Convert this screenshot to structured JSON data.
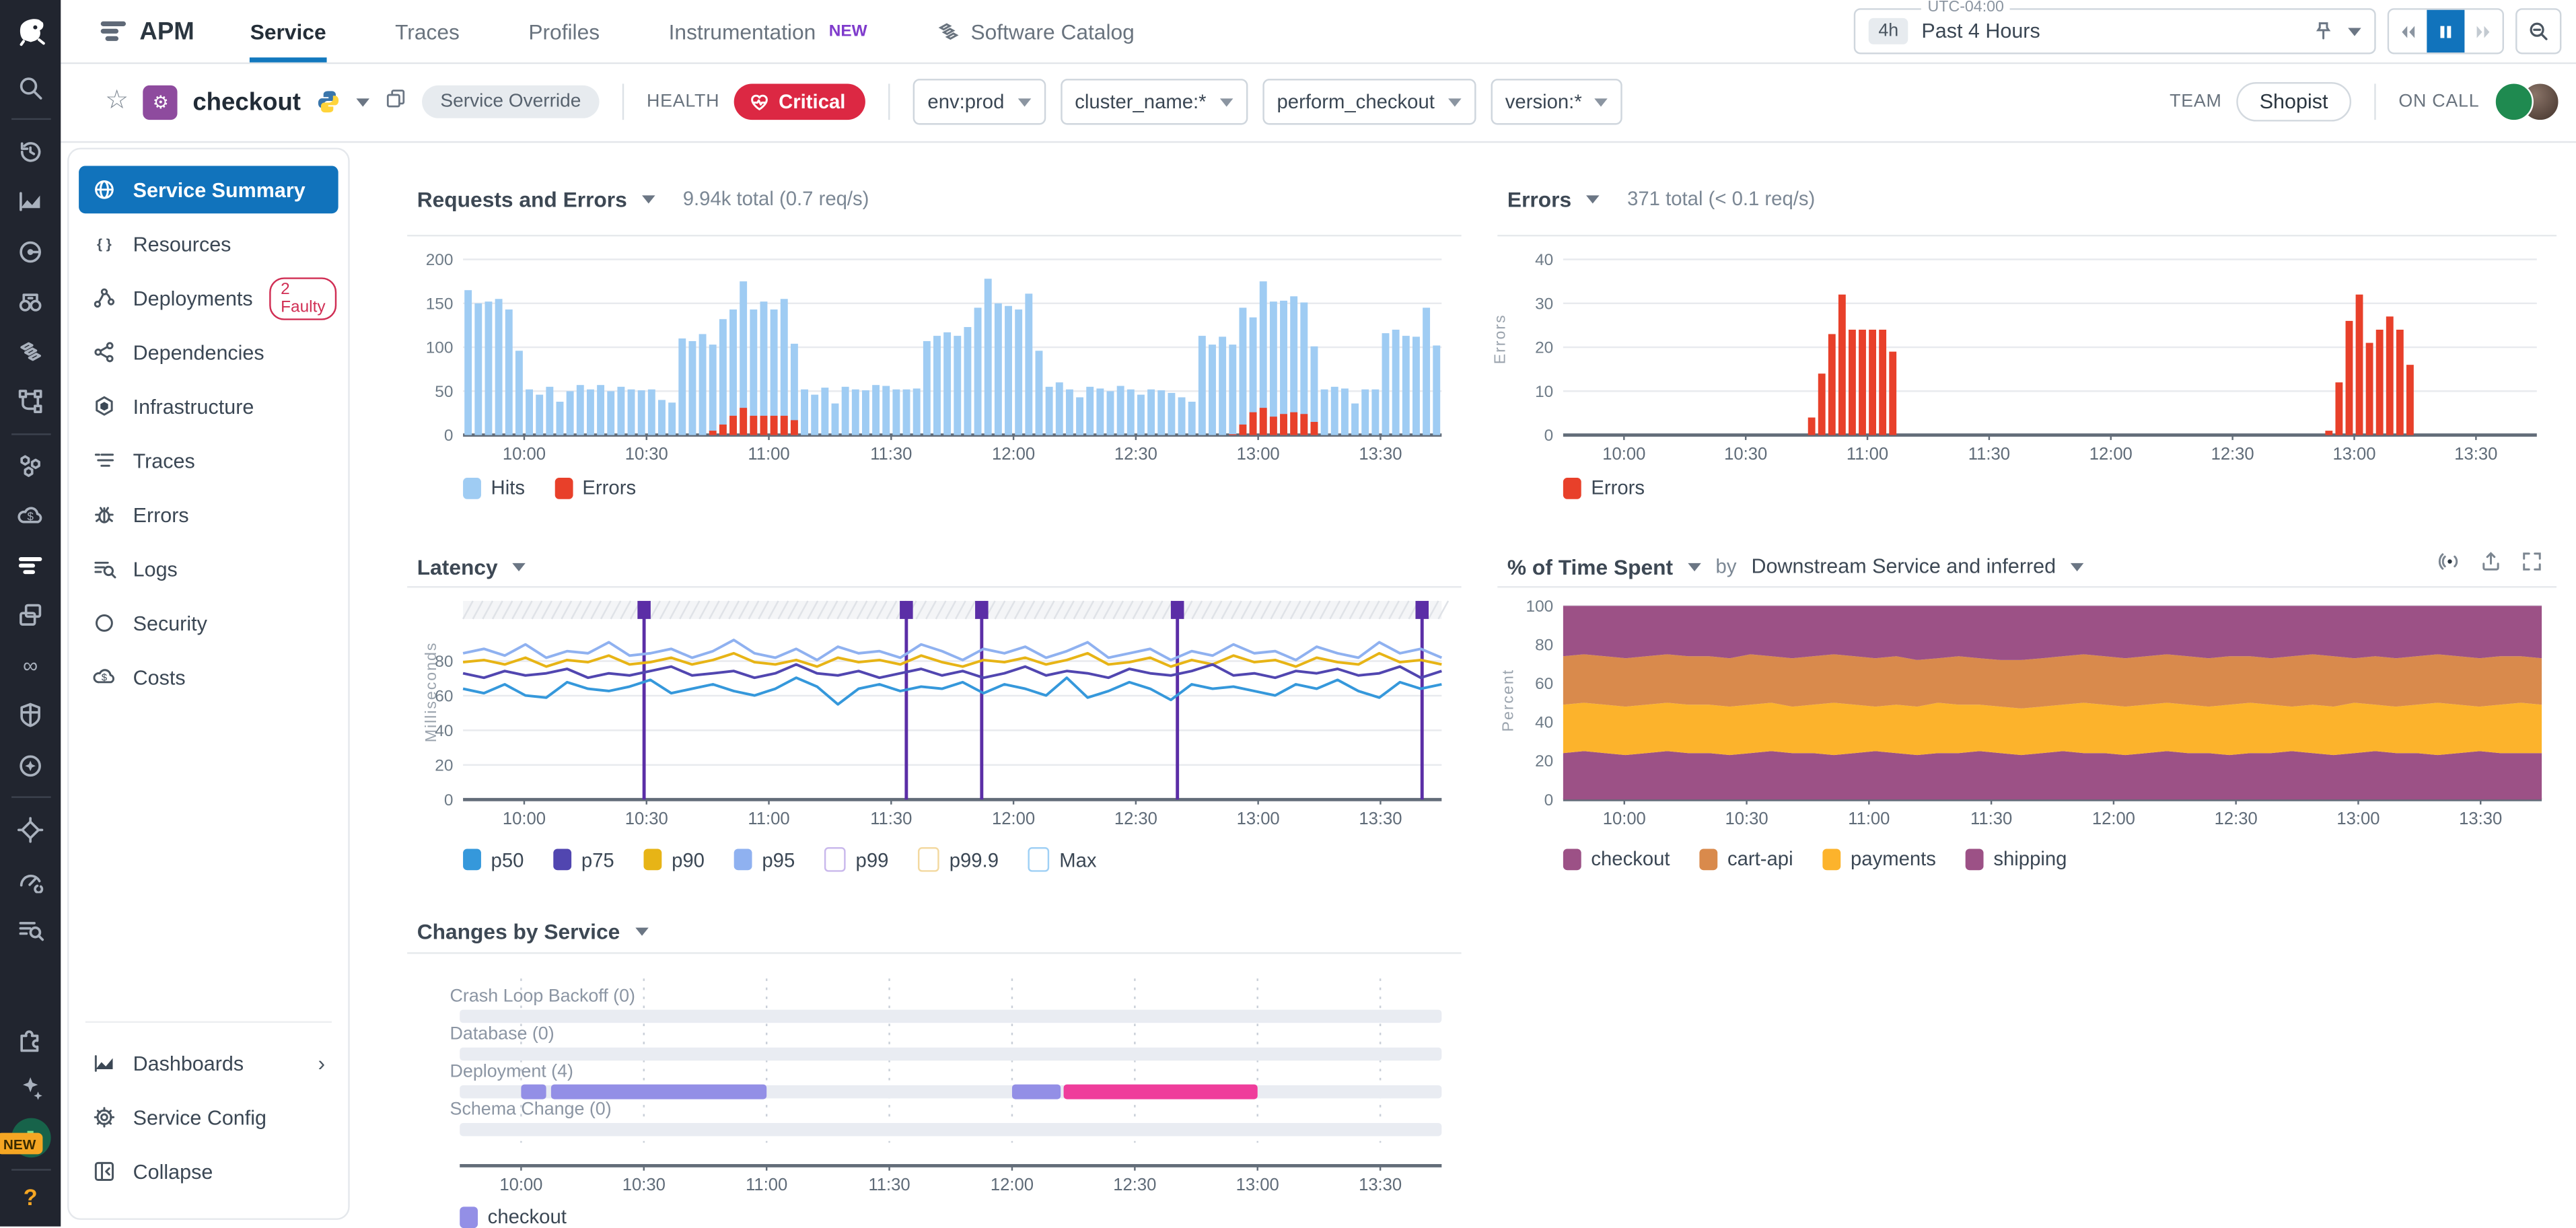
{
  "nav": {
    "product": "APM",
    "tabs": [
      {
        "label": "Service",
        "active": true
      },
      {
        "label": "Traces"
      },
      {
        "label": "Profiles"
      },
      {
        "label": "Instrumentation",
        "badge": "NEW"
      },
      {
        "label": "Software Catalog",
        "icon": "catalog"
      }
    ],
    "time": {
      "tz": "UTC-04:00",
      "range_short": "4h",
      "range_label": "Past 4 Hours"
    }
  },
  "header": {
    "service": "checkout",
    "override_pill": "Service Override",
    "health_label": "HEALTH",
    "health_status": "Critical",
    "filters": [
      "env:prod",
      "cluster_name:*",
      "perform_checkout",
      "version:*"
    ],
    "team_label": "TEAM",
    "team": "Shopist",
    "oncall_label": "ON CALL"
  },
  "sidebar": {
    "items": [
      {
        "label": "Service Summary",
        "icon": "globe",
        "active": true
      },
      {
        "label": "Resources",
        "icon": "braces"
      },
      {
        "label": "Deployments",
        "icon": "deploy",
        "badge": "2 Faulty"
      },
      {
        "label": "Dependencies",
        "icon": "deps"
      },
      {
        "label": "Infrastructure",
        "icon": "hexagon"
      },
      {
        "label": "Traces",
        "icon": "traces"
      },
      {
        "label": "Errors",
        "icon": "bug"
      },
      {
        "label": "Logs",
        "icon": "logs"
      },
      {
        "label": "Security",
        "icon": "shield"
      },
      {
        "label": "Costs",
        "icon": "cloudcost"
      }
    ],
    "footer": [
      {
        "label": "Dashboards",
        "icon": "dash",
        "chevron": true
      },
      {
        "label": "Service Config",
        "icon": "gear"
      },
      {
        "label": "Collapse",
        "icon": "collapse"
      }
    ]
  },
  "rail_icons": {
    "groups": [
      [
        "search"
      ],
      [
        "history",
        "dashboards",
        "infrastructure",
        "watchdog",
        "software-catalog",
        "service-map"
      ],
      [
        "containers",
        "cloud-cost",
        "apm",
        "rum",
        "ci",
        "security",
        "service-management"
      ],
      [
        "error-tracking",
        "performance",
        "log-search"
      ]
    ],
    "active": "apm",
    "bottom": [
      "integrations",
      "bits-ai"
    ],
    "new_badge": "NEW"
  },
  "chart_data": [
    {
      "id": "requests",
      "type": "bar",
      "title": "Requests and Errors",
      "subtitle": "9.94k total (0.7 req/s)",
      "ylim": [
        0,
        200
      ],
      "yticks": [
        0,
        50,
        100,
        150,
        200
      ],
      "xticks": [
        "10:00",
        "10:30",
        "11:00",
        "11:30",
        "12:00",
        "12:30",
        "13:00",
        "13:30"
      ],
      "legend": [
        {
          "label": "Hits",
          "color": "#9fccf3"
        },
        {
          "label": "Errors",
          "color": "#e8402a"
        }
      ],
      "hits": [
        165,
        150,
        152,
        155,
        143,
        96,
        52,
        46,
        55,
        38,
        50,
        57,
        52,
        57,
        50,
        55,
        52,
        51,
        52,
        40,
        37,
        110,
        107,
        115,
        103,
        132,
        143,
        175,
        143,
        152,
        143,
        155,
        104,
        52,
        46,
        54,
        36,
        55,
        52,
        51,
        57,
        56,
        52,
        52,
        53,
        107,
        113,
        117,
        113,
        123,
        145,
        178,
        150,
        147,
        143,
        161,
        96,
        55,
        60,
        52,
        43,
        55,
        53,
        50,
        56,
        52,
        46,
        52,
        51,
        48,
        43,
        38,
        113,
        103,
        112,
        103,
        145,
        134,
        175,
        152,
        153,
        158,
        151,
        101,
        52,
        55,
        53,
        36,
        52,
        52,
        116,
        120,
        113,
        112,
        145,
        102
      ],
      "errors": [
        0,
        0,
        0,
        0,
        0,
        0,
        0,
        0,
        0,
        0,
        0,
        0,
        0,
        0,
        0,
        0,
        0,
        0,
        0,
        0,
        0,
        0,
        0,
        0,
        5,
        12,
        22,
        31,
        22,
        22,
        22,
        22,
        17,
        0,
        0,
        0,
        0,
        0,
        0,
        0,
        0,
        0,
        0,
        0,
        0,
        0,
        0,
        0,
        0,
        0,
        0,
        0,
        0,
        0,
        0,
        0,
        0,
        0,
        0,
        0,
        0,
        0,
        0,
        0,
        0,
        0,
        0,
        0,
        0,
        0,
        0,
        0,
        0,
        0,
        0,
        1,
        12,
        26,
        31,
        21,
        24,
        26,
        24,
        15,
        0,
        0,
        0,
        0,
        0,
        0,
        0,
        0,
        0,
        0,
        0,
        0
      ]
    },
    {
      "id": "errors",
      "type": "bar",
      "title": "Errors",
      "subtitle": "371 total (< 0.1 req/s)",
      "ylabel": "Errors",
      "ylim": [
        0,
        40
      ],
      "yticks": [
        0,
        10,
        20,
        30,
        40
      ],
      "xticks": [
        "10:00",
        "10:30",
        "11:00",
        "11:30",
        "12:00",
        "12:30",
        "13:00",
        "13:30"
      ],
      "legend": [
        {
          "label": "Errors",
          "color": "#e8402a"
        }
      ],
      "errors": [
        0,
        0,
        0,
        0,
        0,
        0,
        0,
        0,
        0,
        0,
        0,
        0,
        0,
        0,
        0,
        0,
        0,
        0,
        0,
        0,
        0,
        0,
        0,
        0,
        4,
        14,
        23,
        32,
        24,
        24,
        24,
        24,
        19,
        0,
        0,
        0,
        0,
        0,
        0,
        0,
        0,
        0,
        0,
        0,
        0,
        0,
        0,
        0,
        0,
        0,
        0,
        0,
        0,
        0,
        0,
        0,
        0,
        0,
        0,
        0,
        0,
        0,
        0,
        0,
        0,
        0,
        0,
        0,
        0,
        0,
        0,
        0,
        0,
        0,
        0,
        1,
        12,
        26,
        32,
        21,
        24,
        27,
        24,
        16,
        0,
        0,
        0,
        0,
        0,
        0,
        0,
        0,
        0,
        0,
        0,
        0
      ]
    },
    {
      "id": "latency",
      "type": "line",
      "title": "Latency",
      "ylabel": "Milliseconds",
      "ylim": [
        0,
        92
      ],
      "yticks": [
        0,
        20,
        40,
        60,
        80
      ],
      "xticks": [
        "10:00",
        "10:30",
        "11:00",
        "11:30",
        "12:00",
        "12:30",
        "13:00",
        "13:30"
      ],
      "deployment_markers": [
        0.185,
        0.453,
        0.53,
        0.73,
        0.98
      ],
      "marker_color": "#5b2ea6",
      "legend": [
        {
          "label": "p50",
          "color": "#3598db",
          "filled": true
        },
        {
          "label": "p75",
          "color": "#5146b0",
          "filled": true
        },
        {
          "label": "p90",
          "color": "#e7b416",
          "filled": true
        },
        {
          "label": "p95",
          "color": "#8fb1f0",
          "filled": true
        },
        {
          "label": "p99",
          "color": "#c9b8ec",
          "filled": false
        },
        {
          "label": "p99.9",
          "color": "#f3d9a0",
          "filled": false
        },
        {
          "label": "Max",
          "color": "#9fd0f5",
          "filled": false
        }
      ],
      "series": [
        {
          "name": "p95",
          "color": "#8fb1f0",
          "values": [
            66,
            68,
            65,
            70,
            64,
            67,
            66,
            71,
            65,
            66,
            68,
            64,
            67,
            72,
            66,
            64,
            68,
            63,
            69,
            66,
            67,
            64,
            70,
            67,
            63,
            68,
            66,
            69,
            64,
            67,
            71,
            64,
            66,
            68,
            63,
            67,
            65,
            70,
            66,
            67,
            63,
            69,
            66,
            64,
            71,
            66,
            68,
            64
          ]
        },
        {
          "name": "p90",
          "color": "#e7b416",
          "values": [
            62,
            63,
            61,
            64,
            60,
            63,
            62,
            65,
            61,
            62,
            64,
            61,
            63,
            66,
            62,
            61,
            63,
            60,
            64,
            62,
            63,
            61,
            65,
            62,
            60,
            63,
            62,
            64,
            61,
            63,
            66,
            61,
            62,
            64,
            60,
            63,
            61,
            65,
            62,
            63,
            60,
            64,
            62,
            61,
            66,
            62,
            63,
            61
          ]
        },
        {
          "name": "p75",
          "color": "#5146b0",
          "values": [
            57,
            55,
            58,
            56,
            57,
            59,
            55,
            57,
            56,
            58,
            60,
            56,
            57,
            58,
            55,
            57,
            61,
            57,
            56,
            58,
            55,
            57,
            59,
            56,
            58,
            55,
            57,
            60,
            56,
            58,
            57,
            55,
            59,
            57,
            56,
            58,
            61,
            56,
            57,
            55,
            58,
            57,
            59,
            56,
            57,
            60,
            55,
            58
          ]
        },
        {
          "name": "p50",
          "color": "#3598db",
          "values": [
            50,
            48,
            52,
            47,
            46,
            53,
            50,
            49,
            51,
            54,
            48,
            50,
            52,
            49,
            47,
            50,
            55,
            51,
            43,
            50,
            52,
            49,
            51,
            50,
            53,
            48,
            52,
            50,
            47,
            55,
            46,
            49,
            53,
            50,
            45,
            52,
            50,
            51,
            49,
            47,
            52,
            50,
            54,
            49,
            46,
            53,
            50,
            52
          ]
        }
      ]
    },
    {
      "id": "time_spent",
      "type": "area",
      "title": "% of Time Spent",
      "by_label": "by",
      "group_label": "Downstream Service and inferred",
      "ylabel": "Percent",
      "ylim": [
        0,
        100
      ],
      "yticks": [
        0,
        20,
        40,
        60,
        80,
        100
      ],
      "xticks": [
        "10:00",
        "10:30",
        "11:00",
        "11:30",
        "12:00",
        "12:30",
        "13:00",
        "13:30"
      ],
      "legend": [
        {
          "label": "checkout",
          "color": "#9c5186"
        },
        {
          "label": "cart-api",
          "color": "#d98a4c"
        },
        {
          "label": "payments",
          "color": "#fcb32c"
        },
        {
          "label": "shipping",
          "color": "#9c5186"
        }
      ],
      "band_colors": [
        "#9c5186",
        "#fcb32c",
        "#d98a4c",
        "#9c5186"
      ],
      "boundaries": [
        [
          24,
          25,
          24,
          23,
          24,
          25,
          24,
          24,
          23,
          24,
          25,
          24,
          24,
          23,
          24,
          25,
          24,
          23,
          24,
          24,
          25,
          24,
          23,
          24,
          25,
          24,
          24,
          23,
          24,
          25,
          24,
          24,
          23,
          24,
          24,
          25,
          24,
          23,
          24,
          25,
          24,
          24,
          23,
          24,
          25,
          24,
          24,
          24
        ],
        [
          49,
          50,
          49,
          48,
          49,
          50,
          49,
          49,
          48,
          49,
          50,
          48,
          49,
          50,
          49,
          48,
          49,
          48,
          50,
          49,
          49,
          48,
          47,
          48,
          49,
          50,
          49,
          48,
          49,
          50,
          49,
          48,
          49,
          50,
          49,
          48,
          49,
          48,
          50,
          49,
          48,
          49,
          50,
          49,
          48,
          49,
          50,
          49
        ],
        [
          74,
          75,
          74,
          73,
          74,
          75,
          74,
          74,
          73,
          75,
          74,
          73,
          74,
          75,
          74,
          73,
          74,
          72,
          73,
          74,
          73,
          72,
          72,
          73,
          74,
          75,
          74,
          73,
          74,
          75,
          74,
          73,
          74,
          74,
          73,
          74,
          75,
          74,
          73,
          74,
          73,
          74,
          75,
          74,
          73,
          74,
          74,
          73
        ]
      ]
    },
    {
      "id": "changes",
      "type": "timeline",
      "title": "Changes by Service",
      "rows": [
        {
          "label": "Crash Loop Backoff (0)",
          "segments": []
        },
        {
          "label": "Database (0)",
          "segments": []
        },
        {
          "label": "Deployment (4)",
          "segments": [
            {
              "from": 0.0625,
              "to": 0.088,
              "color": "#938fe6"
            },
            {
              "from": 0.093,
              "to": 0.3125,
              "color": "#938fe6"
            },
            {
              "from": 0.5625,
              "to": 0.612,
              "color": "#938fe6"
            },
            {
              "from": 0.615,
              "to": 0.8125,
              "color": "#ef3d9b"
            }
          ]
        },
        {
          "label": "Schema Change (0)",
          "segments": []
        }
      ],
      "xticks": [
        "10:00",
        "10:30",
        "11:00",
        "11:30",
        "12:00",
        "12:30",
        "13:00",
        "13:30"
      ],
      "legend": [
        {
          "label": "checkout",
          "color": "#938fe6"
        }
      ]
    }
  ]
}
